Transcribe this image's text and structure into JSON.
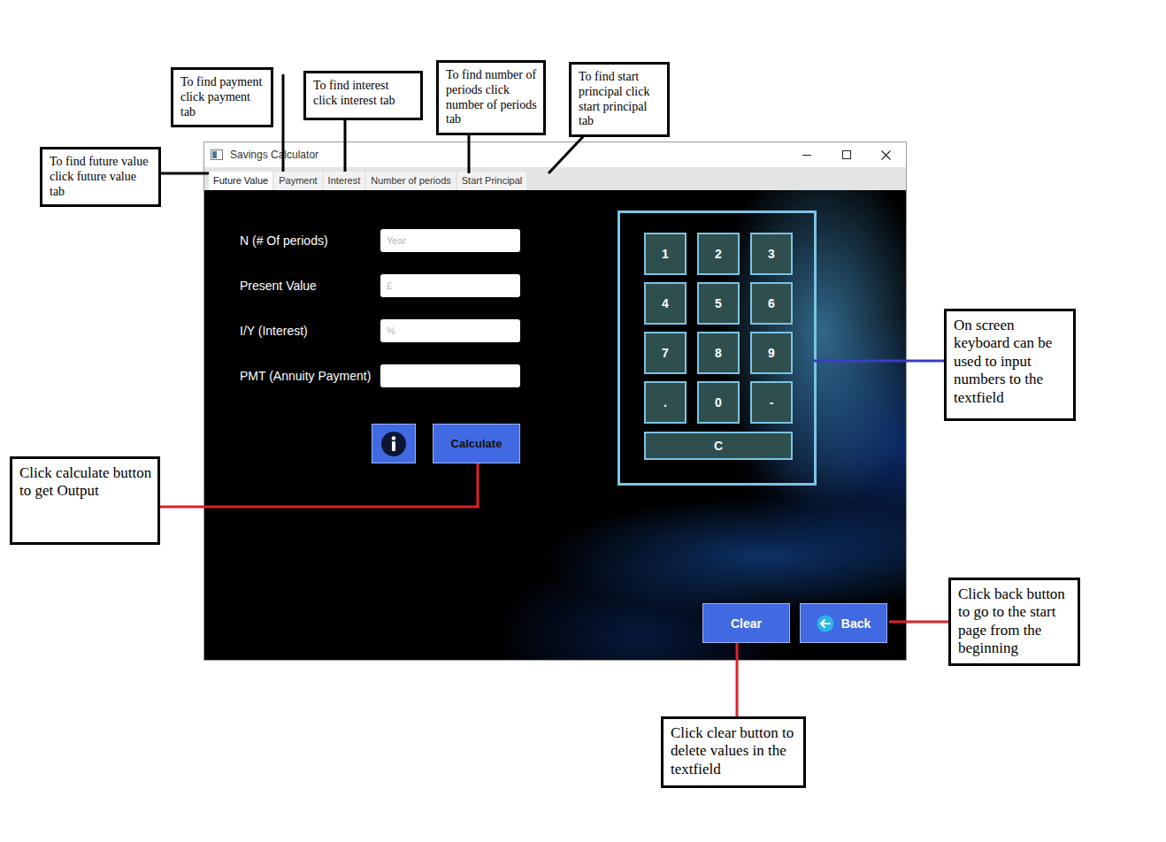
{
  "window": {
    "title": "Savings Calculator"
  },
  "tabs": [
    {
      "label": "Future Value",
      "selected": true
    },
    {
      "label": "Payment",
      "selected": false
    },
    {
      "label": "Interest",
      "selected": false
    },
    {
      "label": "Number of periods",
      "selected": false
    },
    {
      "label": "Start Principal",
      "selected": false
    }
  ],
  "form": {
    "fields": [
      {
        "label": "N (# Of periods)",
        "placeholder": "Year",
        "value": ""
      },
      {
        "label": "Present Value",
        "placeholder": "£",
        "value": ""
      },
      {
        "label": "I/Y (Interest)",
        "placeholder": "%",
        "value": ""
      },
      {
        "label": "PMT (Annuity Payment)",
        "placeholder": "",
        "value": ""
      }
    ],
    "calculate": "Calculate"
  },
  "keypad": {
    "keys": [
      "1",
      "2",
      "3",
      "4",
      "5",
      "6",
      "7",
      "8",
      "9",
      ".",
      "0",
      "-"
    ],
    "clear_key": "C"
  },
  "buttons": {
    "clear": "Clear",
    "back": "Back"
  },
  "annotations": [
    {
      "text": "To find future value click future value tab",
      "color": "#000000"
    },
    {
      "text": "To find payment click payment tab",
      "color": "#000000"
    },
    {
      "text": "To find interest click interest tab",
      "color": "#000000"
    },
    {
      "text": "To find number of periods click number of periods tab",
      "color": "#000000"
    },
    {
      "text": "To find start principal click start principal tab",
      "color": "#000000"
    },
    {
      "text": "On screen keyboard can be used to input numbers to the textfield",
      "color": "#3c3cc8"
    },
    {
      "text": "Click calculate button to get Output",
      "color": "#e0202a"
    },
    {
      "text": "Click back button to go to the start page from the beginning",
      "color": "#e0202a"
    },
    {
      "text": "Click clear button to delete values in the textfield",
      "color": "#e0202a"
    }
  ]
}
